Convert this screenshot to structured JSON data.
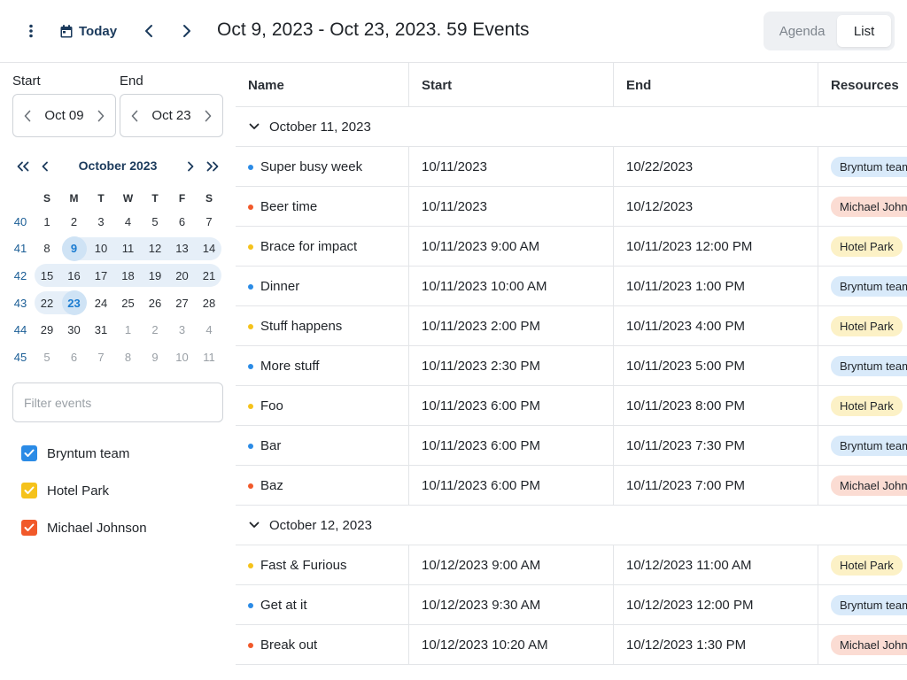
{
  "toolbar": {
    "today_label": "Today",
    "title": "Oct 9, 2023 - Oct 23, 2023. 59 Events",
    "views": [
      {
        "label": "Agenda",
        "active": false
      },
      {
        "label": "List",
        "active": true
      }
    ]
  },
  "sidebar": {
    "start_label": "Start",
    "start_value": "Oct 09",
    "end_label": "End",
    "end_value": "Oct 23",
    "calendar": {
      "month_title": "October 2023",
      "weekdays": [
        "S",
        "M",
        "T",
        "W",
        "T",
        "F",
        "S"
      ],
      "weeks": [
        {
          "num": "40",
          "days": [
            "1",
            "2",
            "3",
            "4",
            "5",
            "6",
            "7"
          ]
        },
        {
          "num": "41",
          "days": [
            "8",
            "9",
            "10",
            "11",
            "12",
            "13",
            "14"
          ]
        },
        {
          "num": "42",
          "days": [
            "15",
            "16",
            "17",
            "18",
            "19",
            "20",
            "21"
          ]
        },
        {
          "num": "43",
          "days": [
            "22",
            "23",
            "24",
            "25",
            "26",
            "27",
            "28"
          ]
        },
        {
          "num": "44",
          "days": [
            "29",
            "30",
            "31",
            "1",
            "2",
            "3",
            "4"
          ]
        },
        {
          "num": "45",
          "days": [
            "5",
            "6",
            "7",
            "8",
            "9",
            "10",
            "11"
          ]
        }
      ]
    },
    "filter_placeholder": "Filter events",
    "resources": [
      {
        "label": "Bryntum team",
        "color": "#2b8be6",
        "checked": true
      },
      {
        "label": "Hotel Park",
        "color": "#f5c21b",
        "checked": true
      },
      {
        "label": "Michael Johnson",
        "color": "#f1592a",
        "checked": true
      }
    ]
  },
  "grid": {
    "columns": [
      "Name",
      "Start",
      "End",
      "Resources"
    ],
    "groups": [
      {
        "title": "October 11, 2023",
        "events": [
          {
            "name": "Super busy week",
            "start": "10/11/2023",
            "end": "10/22/2023",
            "resource": "Bryntum team",
            "color": "#2b8be6"
          },
          {
            "name": "Beer time",
            "start": "10/11/2023",
            "end": "10/12/2023",
            "resource": "Michael Johnson",
            "color": "#f1592a"
          },
          {
            "name": "Brace for impact",
            "start": "10/11/2023 9:00 AM",
            "end": "10/11/2023 12:00 PM",
            "resource": "Hotel Park",
            "color": "#f5c21b"
          },
          {
            "name": "Dinner",
            "start": "10/11/2023 10:00 AM",
            "end": "10/11/2023 1:00 PM",
            "resource": "Bryntum team",
            "color": "#2b8be6"
          },
          {
            "name": "Stuff happens",
            "start": "10/11/2023 2:00 PM",
            "end": "10/11/2023 4:00 PM",
            "resource": "Hotel Park",
            "color": "#f5c21b"
          },
          {
            "name": "More stuff",
            "start": "10/11/2023 2:30 PM",
            "end": "10/11/2023 5:00 PM",
            "resource": "Bryntum team",
            "color": "#2b8be6"
          },
          {
            "name": "Foo",
            "start": "10/11/2023 6:00 PM",
            "end": "10/11/2023 8:00 PM",
            "resource": "Hotel Park",
            "color": "#f5c21b"
          },
          {
            "name": "Bar",
            "start": "10/11/2023 6:00 PM",
            "end": "10/11/2023 7:30 PM",
            "resource": "Bryntum team",
            "color": "#2b8be6"
          },
          {
            "name": "Baz",
            "start": "10/11/2023 6:00 PM",
            "end": "10/11/2023 7:00 PM",
            "resource": "Michael Johnson",
            "color": "#f1592a"
          }
        ]
      },
      {
        "title": "October 12, 2023",
        "events": [
          {
            "name": "Fast & Furious",
            "start": "10/12/2023 9:00 AM",
            "end": "10/12/2023 11:00 AM",
            "resource": "Hotel Park",
            "color": "#f5c21b"
          },
          {
            "name": "Get at it",
            "start": "10/12/2023 9:30 AM",
            "end": "10/12/2023 12:00 PM",
            "resource": "Bryntum team",
            "color": "#2b8be6"
          },
          {
            "name": "Break out",
            "start": "10/12/2023 10:20 AM",
            "end": "10/12/2023 1:30 PM",
            "resource": "Michael Johnson",
            "color": "#f1592a"
          }
        ]
      }
    ]
  }
}
